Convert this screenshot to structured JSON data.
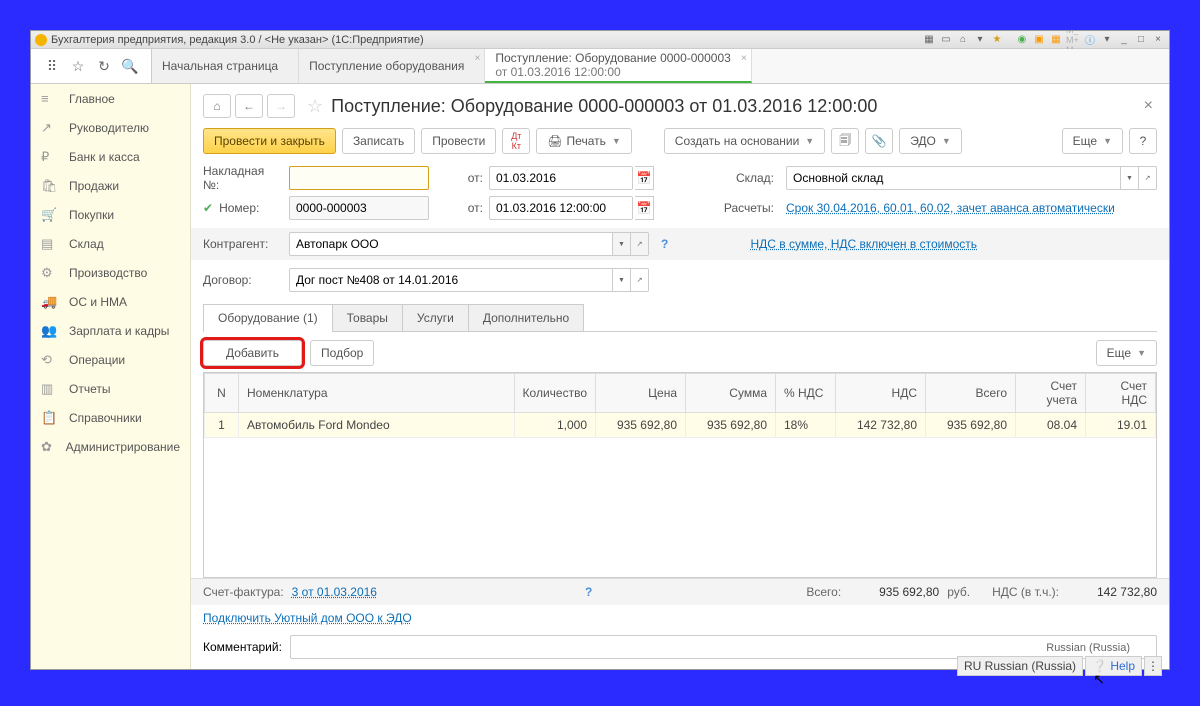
{
  "window": {
    "title": "Бухгалтерия предприятия, редакция 3.0 / <Не указан>  (1С:Предприятие)"
  },
  "tabs_top": [
    {
      "label": "Начальная страница"
    },
    {
      "label": "Поступление оборудования"
    },
    {
      "label_l1": "Поступление: Оборудование 0000-000003",
      "label_l2": "от 01.03.2016 12:00:00"
    }
  ],
  "sidebar": {
    "items": [
      {
        "icon": "≡",
        "label": "Главное"
      },
      {
        "icon": "↗",
        "label": "Руководителю"
      },
      {
        "icon": "₽",
        "label": "Банк и касса"
      },
      {
        "icon": "🛍",
        "label": "Продажи"
      },
      {
        "icon": "🛒",
        "label": "Покупки"
      },
      {
        "icon": "▤",
        "label": "Склад"
      },
      {
        "icon": "⚙",
        "label": "Производство"
      },
      {
        "icon": "🚚",
        "label": "ОС и НМА"
      },
      {
        "icon": "👥",
        "label": "Зарплата и кадры"
      },
      {
        "icon": "⟲",
        "label": "Операции"
      },
      {
        "icon": "▥",
        "label": "Отчеты"
      },
      {
        "icon": "📋",
        "label": "Справочники"
      },
      {
        "icon": "✿",
        "label": "Администрирование"
      }
    ]
  },
  "page": {
    "title": "Поступление: Оборудование 0000-000003 от 01.03.2016 12:00:00"
  },
  "toolbar": {
    "post_close": "Провести и закрыть",
    "write": "Записать",
    "post": "Провести",
    "print": "Печать",
    "create_based": "Создать на основании",
    "edo": "ЭДО",
    "more": "Еще"
  },
  "form": {
    "invoice_no_label": "Накладная №:",
    "invoice_no": "",
    "from_label": "от:",
    "invoice_date": "01.03.2016",
    "number_label": "Номер:",
    "number": "0000-000003",
    "datetime": "01.03.2016 12:00:00",
    "warehouse_label": "Склад:",
    "warehouse": "Основной склад",
    "calc_label": "Расчеты:",
    "calc_link": "Срок 30.04.2016, 60.01, 60.02, зачет аванса автоматически",
    "vat_mode_link": "НДС в сумме, НДС включен в стоимость",
    "counterparty_label": "Контрагент:",
    "counterparty": "Автопарк ООО",
    "contract_label": "Договор:",
    "contract": "Дог пост №408 от 14.01.2016"
  },
  "subtabs": [
    {
      "label": "Оборудование (1)"
    },
    {
      "label": "Товары"
    },
    {
      "label": "Услуги"
    },
    {
      "label": "Дополнительно"
    }
  ],
  "subtoolbar": {
    "add": "Добавить",
    "pick": "Подбор",
    "more": "Еще"
  },
  "table": {
    "columns": [
      "N",
      "Номенклатура",
      "Количество",
      "Цена",
      "Сумма",
      "% НДС",
      "НДС",
      "Всего",
      "Счет учета",
      "Счет НДС"
    ],
    "rows": [
      {
        "n": 1,
        "nomen": "Автомобиль Ford Mondeo",
        "qty": "1,000",
        "price": "935 692,80",
        "sum": "935 692,80",
        "vat_pct": "18%",
        "vat": "142 732,80",
        "total": "935 692,80",
        "acc": "08.04",
        "acc_vat": "19.01"
      }
    ]
  },
  "invoice_footer": {
    "sf_label": "Счет-фактура:",
    "sf_link": "3 от 01.03.2016",
    "total_label": "Всего:",
    "total_value": "935 692,80",
    "currency": "руб.",
    "vat_label": "НДС (в т.ч.):",
    "vat_value": "142 732,80"
  },
  "edo_link": "Подключить Уютный дом ООО к ЭДО",
  "comment_label": "Комментарий:",
  "statusbar": {
    "lang_hint": "Russian (Russia)",
    "ru": "RU",
    "ru_full": "Russian (Russia)",
    "help": "Help"
  }
}
